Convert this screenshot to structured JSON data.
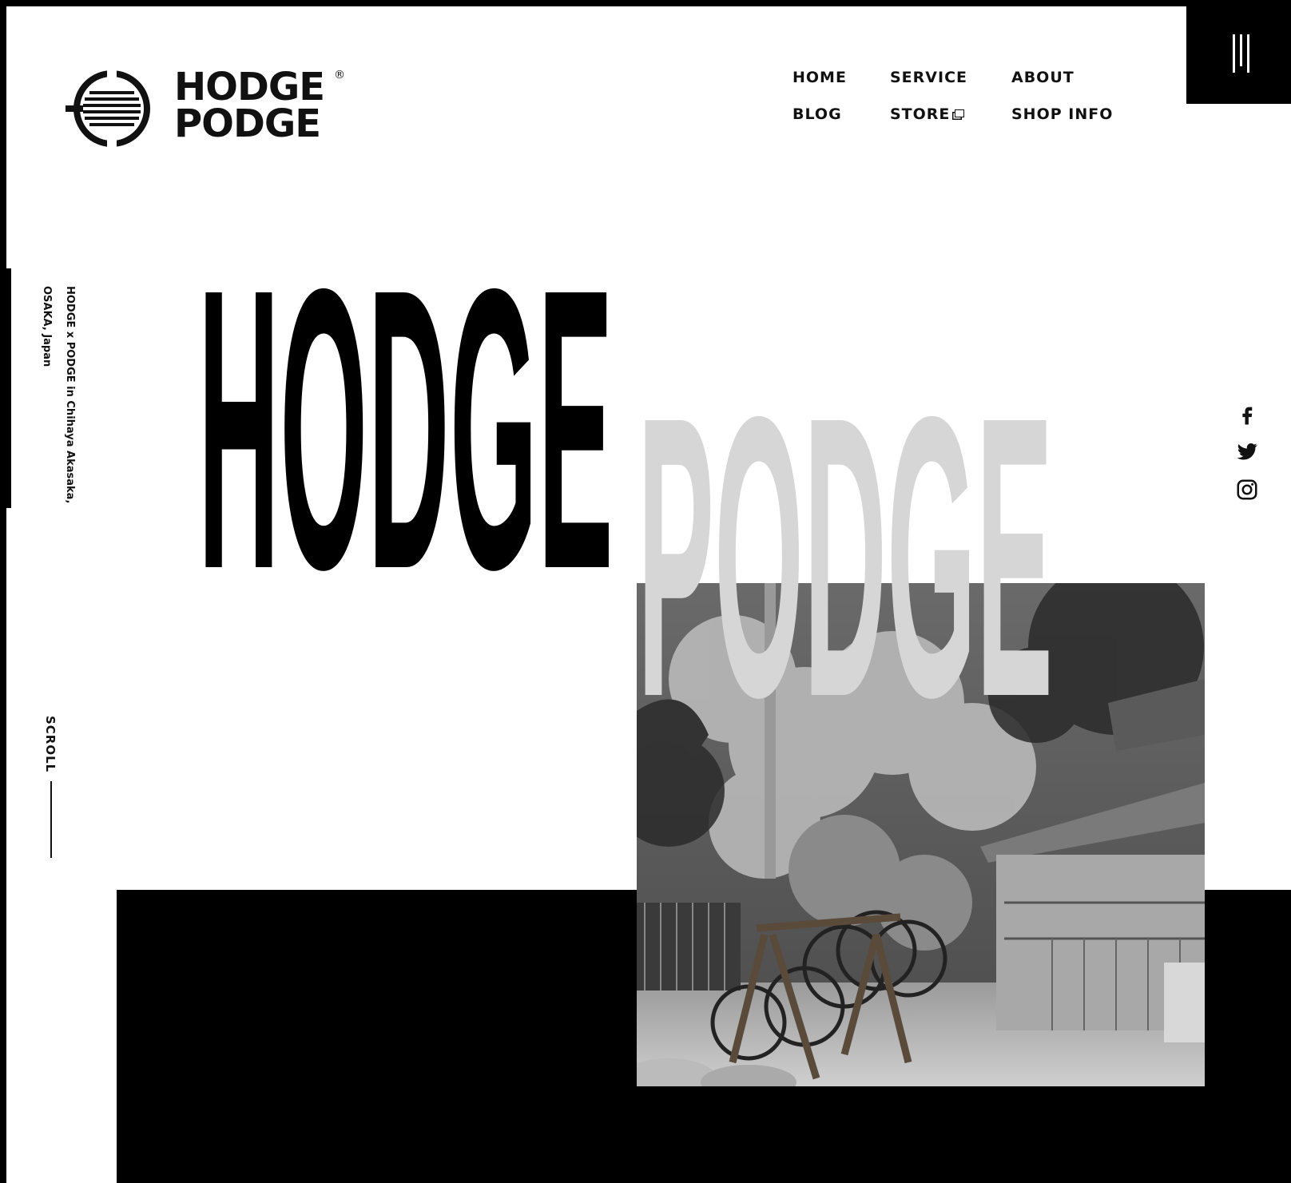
{
  "brand": {
    "logo_line1": "HODGE",
    "logo_line2": "PODGE",
    "logo_mark": "®"
  },
  "nav": {
    "items": [
      {
        "label": "HOME",
        "active": true
      },
      {
        "label": "SERVICE",
        "active": false
      },
      {
        "label": "ABOUT",
        "active": false
      },
      {
        "label": "BLOG",
        "active": false
      },
      {
        "label": "STORE",
        "active": false,
        "external": true
      },
      {
        "label": "SHOP INFO",
        "active": false
      }
    ],
    "accent_color": "#b6e34a"
  },
  "menu_button": {
    "icon": "hamburger-vertical-lines-icon"
  },
  "side": {
    "location_line1": "HODGE x PODGE in Chihaya Akasaka,",
    "location_line2": "OSAKA, Japan",
    "scroll_label": "SCROLL"
  },
  "hero": {
    "word1": "HODGE",
    "word2": "PODGE",
    "word1_color": "#000000",
    "word2_color": "#d6d6d6",
    "photo_alt": "Black and white photo of bicycles on a rack next to a wooden building under trees"
  },
  "social": [
    {
      "name": "facebook-icon"
    },
    {
      "name": "twitter-icon"
    },
    {
      "name": "instagram-icon"
    }
  ]
}
